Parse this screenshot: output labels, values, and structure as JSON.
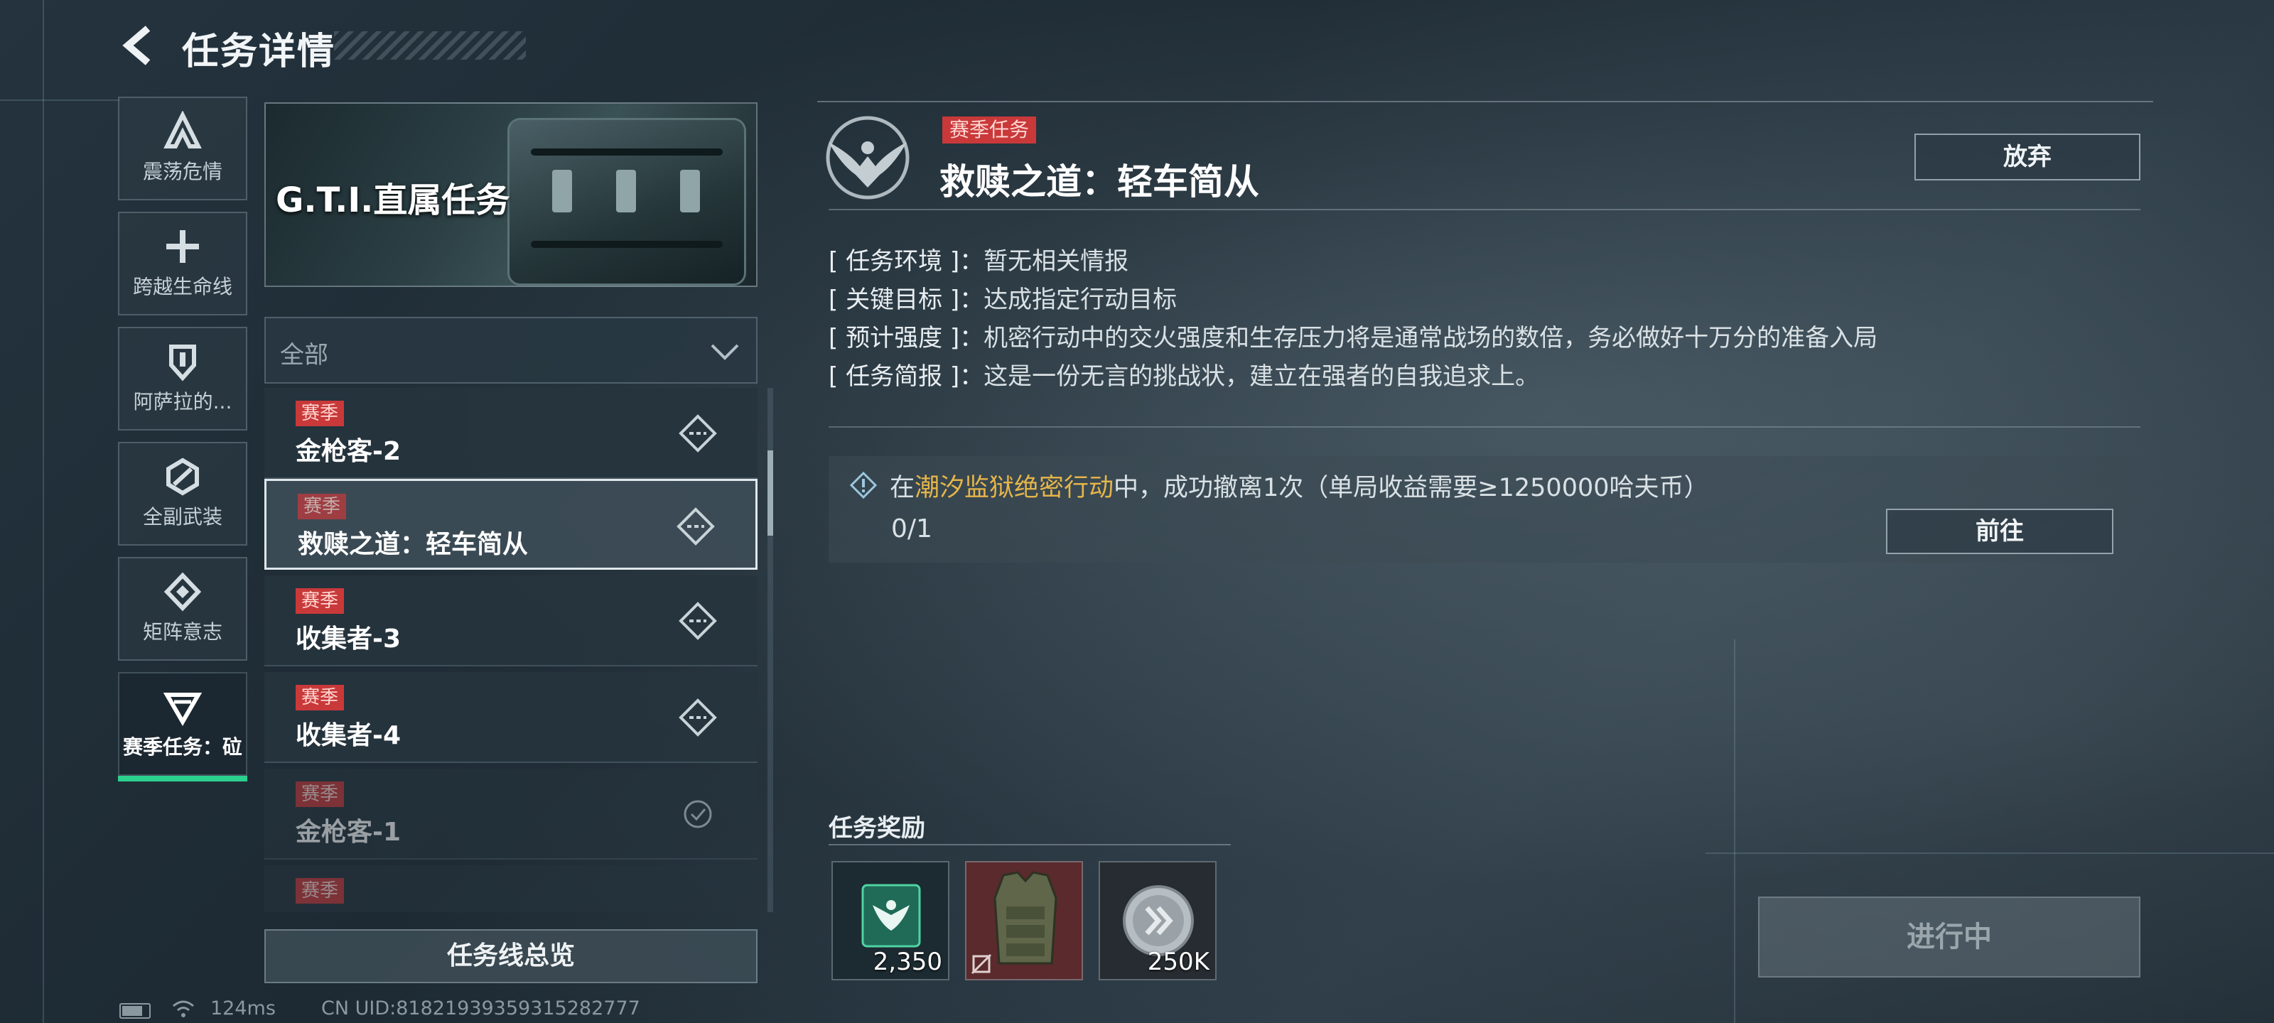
{
  "header": {
    "title": "任务详情"
  },
  "categories": [
    {
      "label": "震荡危情",
      "icon": "a-logo-icon"
    },
    {
      "label": "跨越生命线",
      "icon": "plus-icon"
    },
    {
      "label": "阿萨拉的...",
      "icon": "shield-icon"
    },
    {
      "label": "全副武装",
      "icon": "hexagon-icon"
    },
    {
      "label": "矩阵意志",
      "icon": "diamond-icon"
    },
    {
      "label": "赛季任务：砬",
      "icon": "triangle-icon",
      "active": true
    }
  ],
  "banner": {
    "title": "G.T.I.直属任务"
  },
  "filter": {
    "selected": "全部"
  },
  "tasks": [
    {
      "tag": "赛季",
      "name": "金枪客-2",
      "status": "available"
    },
    {
      "tag": "赛季",
      "name": "救赎之道：轻车简从",
      "status": "selected"
    },
    {
      "tag": "赛季",
      "name": "收集者-3",
      "status": "available"
    },
    {
      "tag": "赛季",
      "name": "收集者-4",
      "status": "available"
    },
    {
      "tag": "赛季",
      "name": "金枪客-1",
      "status": "completed"
    },
    {
      "tag": "赛季",
      "name": "",
      "status": "completed"
    }
  ],
  "overview_button": "任务线总览",
  "status_bar": {
    "ping": "124ms",
    "uid": "CN UID:81821939359315282777"
  },
  "detail": {
    "tag": "赛季任务",
    "title": "救赎之道：轻车简从",
    "abandon_label": "放弃",
    "info": [
      {
        "key": "[ 任务环境 ]：",
        "value": "暂无相关情报"
      },
      {
        "key": "[ 关键目标 ]：",
        "value": "达成指定行动目标"
      },
      {
        "key": "[ 预计强度 ]：",
        "value": "机密行动中的交火强度和生存压力将是通常战场的数倍，务必做好十万分的准备入局"
      },
      {
        "key": "[ 任务简报 ]：",
        "value": "这是一份无言的挑战状，建立在强者的自我追求上。"
      }
    ],
    "objective": {
      "prefix": "在",
      "highlight": "潮汐监狱绝密行动",
      "suffix": "中，成功撤离1次（单局收益需要≥1250000哈夫币）",
      "progress": "0/1",
      "goto_label": "前往"
    },
    "rewards_title": "任务奖励",
    "rewards": [
      {
        "icon": "emblem-card-icon",
        "qty": "2,350",
        "bg": "#1f6b57"
      },
      {
        "icon": "body-armor-icon",
        "qty": "",
        "bg": "#5a2a2c"
      },
      {
        "icon": "coin-icon",
        "qty": "250K",
        "bg": "#2a3036"
      }
    ],
    "status_button": "进行中"
  },
  "colors": {
    "accent_green": "#2bd08e",
    "tag_red": "#c9393a",
    "highlight_gold": "#e5b54a"
  }
}
